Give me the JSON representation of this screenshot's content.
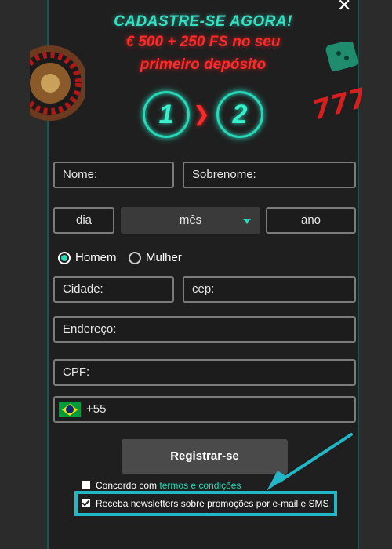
{
  "header": {
    "line1": "CADASTRE-SE AGORA!",
    "line2": "€ 500 + 250 FS no seu",
    "line3": "primeiro depósito",
    "step1": "1",
    "step2": "2",
    "close": "✕"
  },
  "form": {
    "nome": "Nome:",
    "sobrenome": "Sobrenome:",
    "dia": "dia",
    "mes": "mês",
    "ano": "ano",
    "gender_male": "Homem",
    "gender_female": "Mulher",
    "cidade": "Cidade:",
    "cep": "cep:",
    "endereco": "Endereço:",
    "cpf": "CPF:",
    "phone_code": "+55"
  },
  "actions": {
    "register": "Registrar-se",
    "terms_prefix": "Concordo com",
    "terms_link": "termos e condições",
    "newsletter": "Receba newsletters sobre promoções por e-mail e SMS"
  },
  "colors": {
    "accent": "#27d9b9",
    "highlight": "#21b7c6",
    "promo": "#ff2a2a",
    "panel": "#1f1f1f"
  }
}
